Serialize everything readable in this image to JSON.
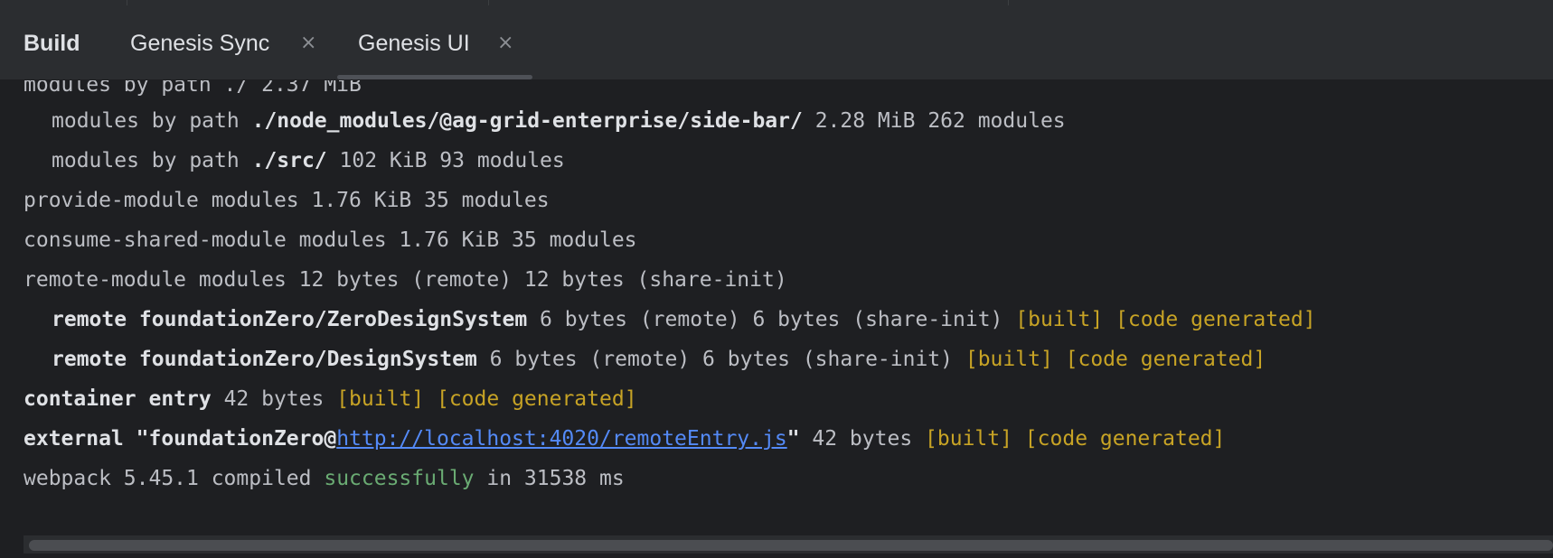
{
  "tabs": [
    {
      "label": "Build"
    },
    {
      "label": "Genesis Sync"
    },
    {
      "label": "Genesis UI"
    }
  ],
  "console": {
    "lines": [
      [
        {
          "t": "modules by path ./ 2.37 MiB",
          "s": ""
        }
      ],
      [
        {
          "t": "modules by path ",
          "s": ""
        },
        {
          "t": "./node_modules/@ag-grid-enterprise/side-bar/",
          "s": "b"
        },
        {
          "t": " 2.28 MiB 262 modules",
          "s": ""
        }
      ],
      [
        {
          "t": "modules by path ",
          "s": ""
        },
        {
          "t": "./src/",
          "s": "b"
        },
        {
          "t": " 102 KiB 93 modules",
          "s": ""
        }
      ],
      [
        {
          "t": "provide-module modules 1.76 KiB 35 modules",
          "s": ""
        }
      ],
      [
        {
          "t": "consume-shared-module modules 1.76 KiB 35 modules",
          "s": ""
        }
      ],
      [
        {
          "t": "remote-module modules 12 bytes (remote) 12 bytes (share-init)",
          "s": ""
        }
      ],
      [
        {
          "t": "remote foundationZero/ZeroDesignSystem",
          "s": "b"
        },
        {
          "t": " 6 bytes (remote) 6 bytes (share-init) ",
          "s": ""
        },
        {
          "t": "[built] [code generated]",
          "s": "y"
        }
      ],
      [
        {
          "t": "remote foundationZero/DesignSystem",
          "s": "b"
        },
        {
          "t": " 6 bytes (remote) 6 bytes (share-init) ",
          "s": ""
        },
        {
          "t": "[built] [code generated]",
          "s": "y"
        }
      ],
      [
        {
          "t": "container entry",
          "s": "b"
        },
        {
          "t": " 42 bytes ",
          "s": ""
        },
        {
          "t": "[built] [code generated]",
          "s": "y"
        }
      ],
      [
        {
          "t": "external \"foundationZero@",
          "s": "b"
        },
        {
          "t": "http://localhost:4020/remoteEntry.js",
          "s": "lnk"
        },
        {
          "t": "\"",
          "s": "b"
        },
        {
          "t": " 42 bytes ",
          "s": ""
        },
        {
          "t": "[built] [code generated]",
          "s": "y"
        }
      ],
      [
        {
          "t": "webpack 5.45.1 compiled ",
          "s": ""
        },
        {
          "t": "successfully",
          "s": "g"
        },
        {
          "t": " in 31538 ms",
          "s": ""
        }
      ]
    ]
  }
}
